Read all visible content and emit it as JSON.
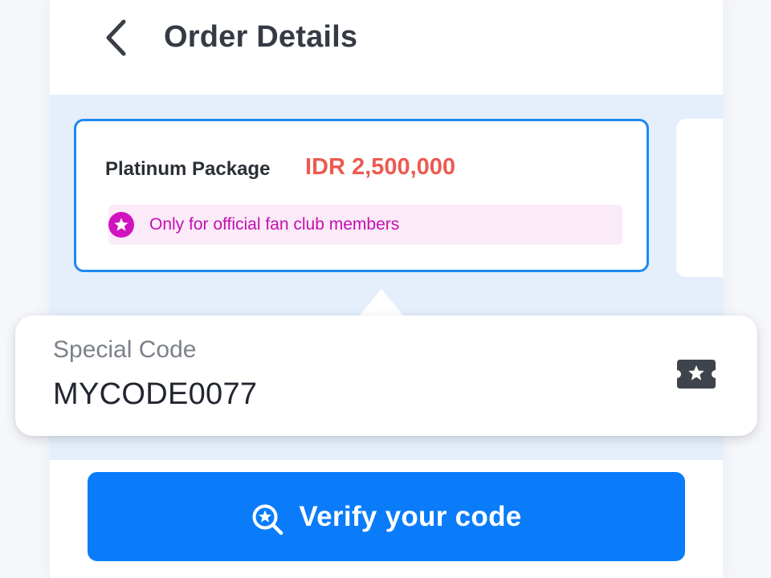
{
  "header": {
    "back_icon": "chevron-left-icon",
    "title": "Order Details"
  },
  "package_card": {
    "name": "Platinum Package",
    "price": "IDR 2,500,000",
    "price_color": "#EC5A52",
    "border_color": "#1E88F2",
    "membership_icon": "star-badge-icon",
    "membership_note": "Only for official fan club members",
    "membership_color": "#C50FB2"
  },
  "special_code": {
    "label": "Special Code",
    "value": "MYCODE0077",
    "icon": "ticket-star-icon"
  },
  "verify_button": {
    "icon": "search-badge-icon",
    "label": "Verify your code",
    "color": "#0A7CFA"
  }
}
